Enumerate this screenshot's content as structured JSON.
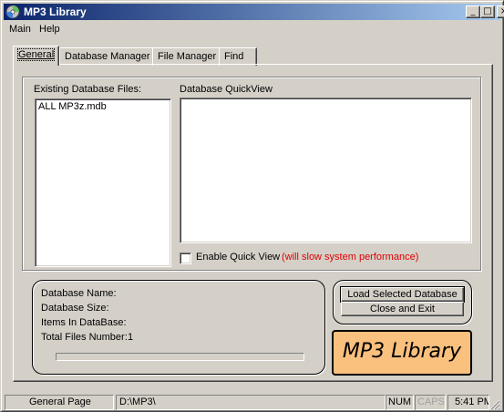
{
  "window": {
    "title": "MP3 Library",
    "controls": {
      "minimize": "_",
      "maximize": "□",
      "close": "×"
    }
  },
  "menu": [
    {
      "label": "Main"
    },
    {
      "label": "Help"
    }
  ],
  "tabs": [
    {
      "label": "General",
      "active": true
    },
    {
      "label": "Database Manager"
    },
    {
      "label": "File Manager"
    },
    {
      "label": "Find"
    }
  ],
  "general": {
    "existing_files_label": "Existing Database Files:",
    "files": [
      "ALL MP3z.mdb"
    ],
    "quickview_label": "Database QuickView",
    "enable_quickview": {
      "label": "Enable Quick View",
      "warning": "(will slow system performance)",
      "checked": false
    },
    "info": {
      "name_label": "Database Name:",
      "size_label": "Database Size:",
      "items_label": "Items In DataBase:",
      "total_label": "Total Files Number:",
      "total_value": "1",
      "progress": 0
    },
    "load_button": "Load Selected Database",
    "close_button": "Close and Exit",
    "logo_text": "MP3 Library"
  },
  "status": {
    "page": "General Page",
    "path": "D:\\MP3\\",
    "num": "NUM",
    "caps": "CAPS",
    "time": "5:41 PM"
  },
  "colors": {
    "title_gradient_start": "#0a246a",
    "title_gradient_end": "#a6caf0",
    "warning_text": "#e00000",
    "logo_bg": "#f9c07e",
    "disabled_text": "#a0a0a0"
  }
}
